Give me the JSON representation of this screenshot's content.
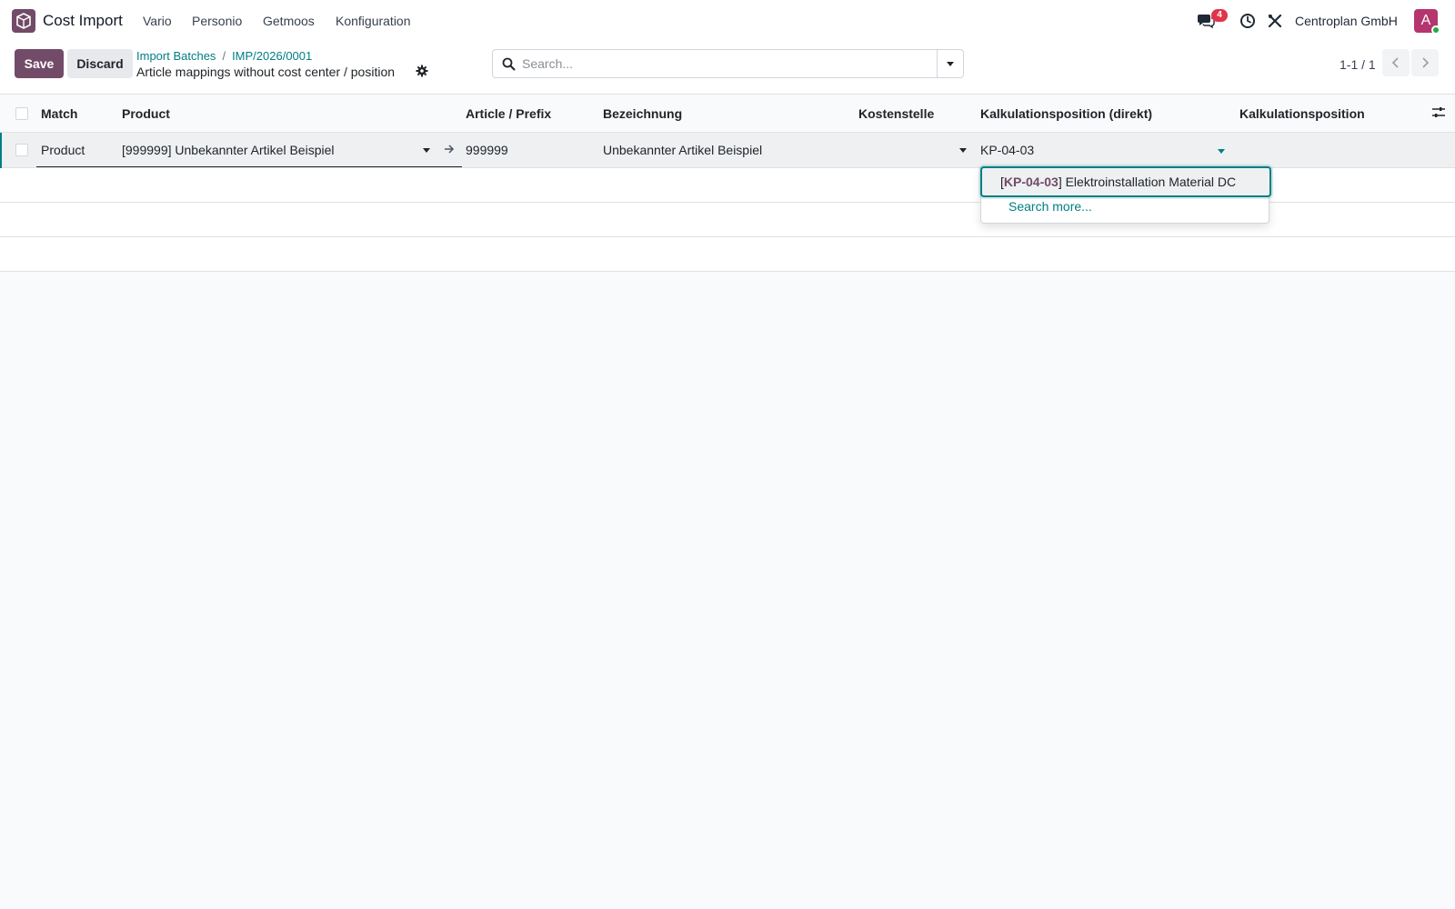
{
  "navbar": {
    "app_name": "Cost Import",
    "menu": [
      "Vario",
      "Personio",
      "Getmoos",
      "Konfiguration"
    ],
    "messages_badge": "4",
    "company": "Centroplan GmbH",
    "avatar_letter": "A",
    "icons": [
      "app-logo-icon",
      "chat-icon",
      "clock-icon",
      "tools-icon"
    ]
  },
  "control_panel": {
    "save_label": "Save",
    "discard_label": "Discard",
    "breadcrumb": [
      "Import Batches",
      "IMP/2026/0001"
    ],
    "breadcrumb_sep": "/",
    "title": "Article mappings without cost center / position",
    "search_placeholder": "Search...",
    "pager": "1-1 / 1"
  },
  "table": {
    "columns": [
      "Match",
      "Product",
      "Article / Prefix",
      "Bezeichnung",
      "Kostenstelle",
      "Kalkulationsposition (direkt)",
      "Kalkulationsposition"
    ],
    "rows": [
      {
        "match": "Product",
        "product": "[999999] Unbekannter Artikel Beispiel",
        "article": "999999",
        "bezeichnung": "Unbekannter Artikel Beispiel",
        "kostenstelle": "",
        "kalk_direkt": "KP-04-03",
        "kalk": ""
      }
    ]
  },
  "autocomplete": {
    "option_code": "KP-04-03",
    "option_rest": "] Elektroinstallation Material DC",
    "option_bracket": "[",
    "search_more": "Search more..."
  },
  "colors": {
    "brand": "#714b67",
    "link": "#017e84",
    "badge": "#e0344a"
  }
}
